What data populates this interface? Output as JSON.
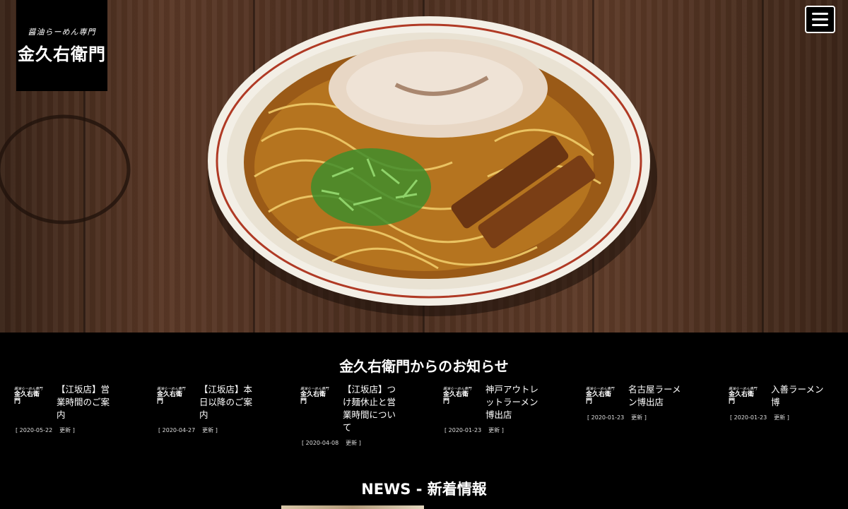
{
  "logo": {
    "line1": "醤油らーめん専門",
    "line2": "金久右衛門"
  },
  "menu": {
    "icon": "hamburger-icon"
  },
  "notices": {
    "heading": "金久右衛門からのお知らせ",
    "items": [
      {
        "title": "【江坂店】営業時間のご案内",
        "date": "[ 2020-05-22",
        "updated": "更新 ]"
      },
      {
        "title": "【江坂店】本日以降のご案内",
        "date": "[ 2020-04-27",
        "updated": "更新 ]"
      },
      {
        "title": "【江坂店】つけ麺休止と営業時間について",
        "date": "[ 2020-04-08",
        "updated": "更新 ]"
      },
      {
        "title": "神戸アウトレットラーメン博出店",
        "date": "[ 2020-01-23",
        "updated": "更新 ]"
      },
      {
        "title": "名古屋ラーメン博出店",
        "date": "[ 2020-01-23",
        "updated": "更新 ]"
      },
      {
        "title": "入善ラーメン博",
        "date": "[ 2020-01-23",
        "updated": "更新 ]"
      }
    ]
  },
  "news": {
    "heading": "NEWS - 新着情報"
  }
}
